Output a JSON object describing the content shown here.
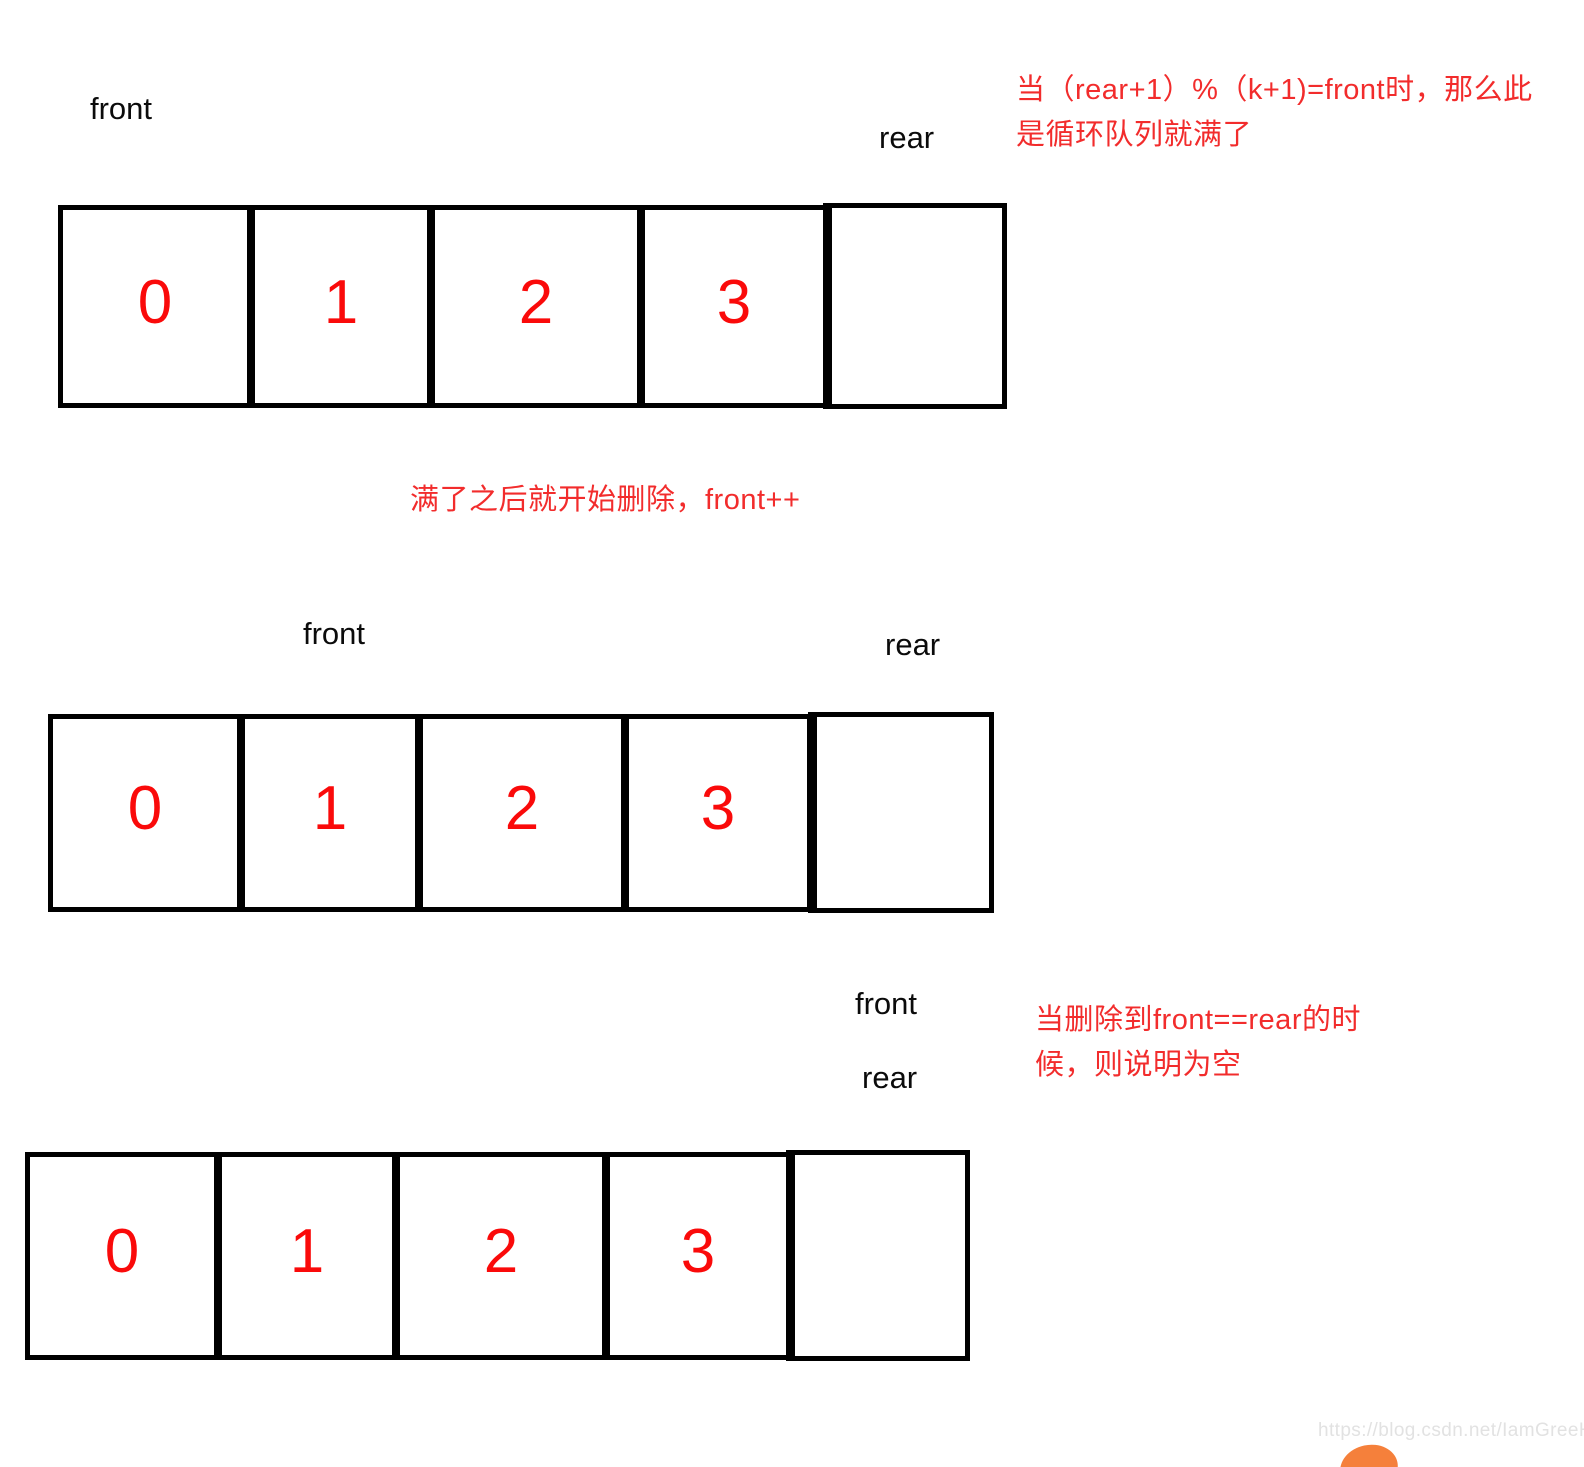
{
  "page": {
    "background": "#ffffff",
    "value_color": "#fa0a0a",
    "annotation_color": "#f22c2c",
    "border_color": "#000000"
  },
  "rows": [
    {
      "id": "row-full",
      "cells": [
        {
          "value": "0"
        },
        {
          "value": "1"
        },
        {
          "value": "2"
        },
        {
          "value": "3"
        },
        {
          "value": ""
        }
      ],
      "pointers": {
        "front": "front",
        "rear": "rear"
      }
    },
    {
      "id": "row-after-delete",
      "cells": [
        {
          "value": "0"
        },
        {
          "value": "1"
        },
        {
          "value": "2"
        },
        {
          "value": "3"
        },
        {
          "value": ""
        }
      ],
      "pointers": {
        "front": "front",
        "rear": "rear"
      }
    },
    {
      "id": "row-empty",
      "cells": [
        {
          "value": "0"
        },
        {
          "value": "1"
        },
        {
          "value": "2"
        },
        {
          "value": "3"
        },
        {
          "value": ""
        }
      ],
      "pointers": {
        "front": "front",
        "rear": "rear"
      }
    }
  ],
  "annotations": {
    "full_condition": "当（rear+1）%（k+1)=front时，那么此\n是循环队列就满了",
    "delete_step": "满了之后就开始删除，front++",
    "empty_condition": "当删除到front==rear的时\n候，则说明为空"
  },
  "watermark": {
    "url": "https://blog.csdn.net/IamGreeHand"
  }
}
